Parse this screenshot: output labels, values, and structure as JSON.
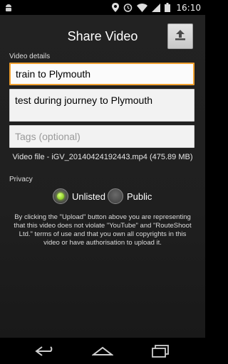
{
  "status": {
    "time": "16:10"
  },
  "icons": {
    "status_left": "android-debug-icon",
    "location": "location-pin-icon",
    "alarm": "alarm-icon",
    "wifi": "wifi-icon",
    "signal": "cell-signal-icon",
    "battery": "battery-icon",
    "upload": "upload-icon",
    "back": "back-nav-icon",
    "home": "home-nav-icon",
    "recents": "recents-nav-icon"
  },
  "header": {
    "title": "Share Video"
  },
  "video_details": {
    "label": "Video details",
    "title_value": "train to Plymouth",
    "description_value": "test during journey to Plymouth",
    "tags_placeholder": "Tags (optional)",
    "video_file": "Video file - iGV_20140424192443.mp4 (475.89 MB)"
  },
  "privacy": {
    "label": "Privacy",
    "options": [
      {
        "label": "Unlisted",
        "selected": true
      },
      {
        "label": "Public",
        "selected": false
      }
    ]
  },
  "disclaimer": "By clicking the \"Upload\" button above you are representing that this video does not violate \"YouTube\" and \"RouteShoot Ltd.\" terms of use and that you own all copyrights in this video or have authorisation to upload it."
}
